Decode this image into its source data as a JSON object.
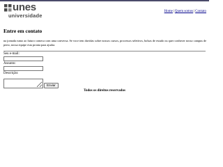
{
  "logo": {
    "main": "unes",
    "sub": "universidade"
  },
  "nav": {
    "items": [
      "Home",
      "Quem somos",
      "Contato"
    ],
    "separator": "|"
  },
  "page": {
    "title": "Entre em contato",
    "intro": "na jornada rumo ao futuro comeca com uma conversa. Se voce tem duvidas sobre nossos cursos, processos seletivos, bolsas de estudo ou quer conhecer nosso campus de perto, nossa equipe esta pronta para ajudar."
  },
  "form": {
    "email_label": "Seu e-mail:",
    "email_value": "",
    "subject_label": "Assunto:",
    "subject_value": "",
    "description_label": "Descrição:",
    "description_value": "",
    "submit_label": "Enviar"
  },
  "footer": {
    "text": "Todos os direitos reservados"
  },
  "colors": {
    "topbar": "#4a4a6a",
    "logo": "#4a4a4a",
    "link": "#00008b"
  }
}
